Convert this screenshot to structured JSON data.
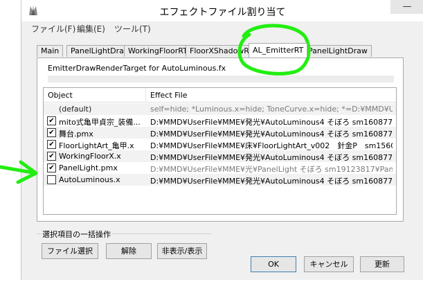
{
  "window": {
    "title": "エフェクトファイル割り当て",
    "minimize_glyph": "—"
  },
  "menu": [
    "ファイル(F)",
    "編集(E)",
    "ツール(T)"
  ],
  "tabs": [
    "Main",
    "PanelLightDraw",
    "WorkingFloorRT",
    "FloorXShadowRT",
    "AL_EmitterRT",
    "PanelLightDraw"
  ],
  "active_tab_index": 4,
  "panel": {
    "target_label": "EmitterDrawRenderTarget for AutoLuminous.fx"
  },
  "list": {
    "columns": [
      "Object",
      "Effect File"
    ],
    "rows": [
      {
        "checked": null,
        "object": "(default)",
        "effect": "self=hide; *Luminous.x=hide; ToneCurve.x=hide; *=D:¥MMD¥Us..."
      },
      {
        "checked": "✔",
        "object": "mito式亀甲貞宗_装備...",
        "effect": "D:¥MMD¥UserFile¥MME¥発光¥AutoLuminous4 そぼろ sm1608775..."
      },
      {
        "checked": "✔",
        "object": "舞台.pmx",
        "effect": "D:¥MMD¥UserFile¥MME¥発光¥AutoLuminous4 そぼろ sm1608775..."
      },
      {
        "checked": "✔",
        "object": "FloorLightArt_亀甲.x",
        "effect": "D:¥MMD¥UserFile¥MME¥床¥FloorLightArt_v002　針金P　sm1560..."
      },
      {
        "checked": "✔",
        "object": "WorkingFloorX.x",
        "effect": "D:¥MMD¥UserFile¥MME¥発光¥AutoLuminous4 そぼろ sm1608775..."
      },
      {
        "checked": "✔",
        "object": "PanelLight.pmx",
        "effect": "D:¥MMD¥UserFile¥MME¥光¥PanelLight そぼろ sm19123817¥Panel..."
      },
      {
        "checked": "",
        "object": "AutoLuminous.x",
        "effect": "D:¥MMD¥UserFile¥MME¥発光¥AutoLuminous4 そぼろ sm1608775..."
      }
    ]
  },
  "bulk_group": {
    "label": "選択項目の一括操作",
    "buttons": [
      "ファイル選択",
      "解除",
      "非表示/表示"
    ]
  },
  "footer": {
    "ok": "OK",
    "cancel": "キャンセル",
    "update": "更新"
  },
  "colors": {
    "annotation_green": "#22ee11",
    "window_bg": "#f0f0f0",
    "focus_border": "#3c7fb1"
  },
  "icons": {
    "app": "app-icon",
    "checkbox_mark": "check-icon"
  }
}
